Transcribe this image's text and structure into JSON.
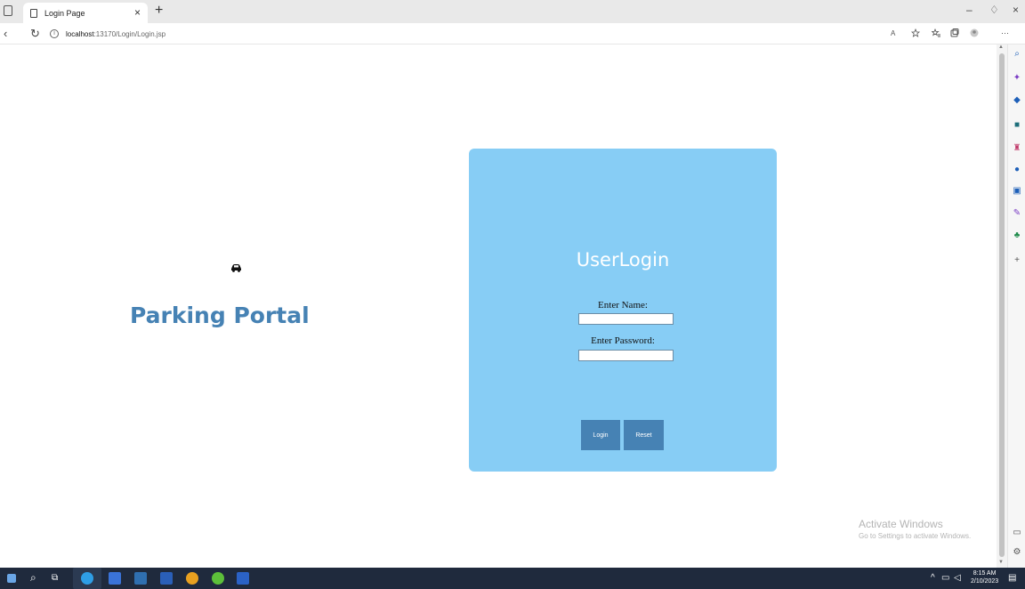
{
  "browser": {
    "tab_title": "Login Page",
    "tab_close": "×",
    "new_tab": "+",
    "url_host": "localhost",
    "url_path": ":13170/Login/Login.jsp",
    "minimize": "–",
    "restore": "♢",
    "close": "×",
    "more": "···"
  },
  "page": {
    "brand": "Parking Portal",
    "login": {
      "title": "UserLogin",
      "name_label": "Enter Name:",
      "name_value": "",
      "password_label": "Enter Password:",
      "password_value": "",
      "login_button": "Login",
      "reset_button": "Reset"
    },
    "watermark": {
      "title": "Activate Windows",
      "subtitle": "Go to Settings to activate Windows."
    }
  },
  "taskbar": {
    "time": "8:15 AM",
    "date": "2/10/2023"
  },
  "colors": {
    "brand": "#4682b4",
    "card": "#87cdf5",
    "button": "#4682b4",
    "taskbar": "#1f2a3d"
  }
}
